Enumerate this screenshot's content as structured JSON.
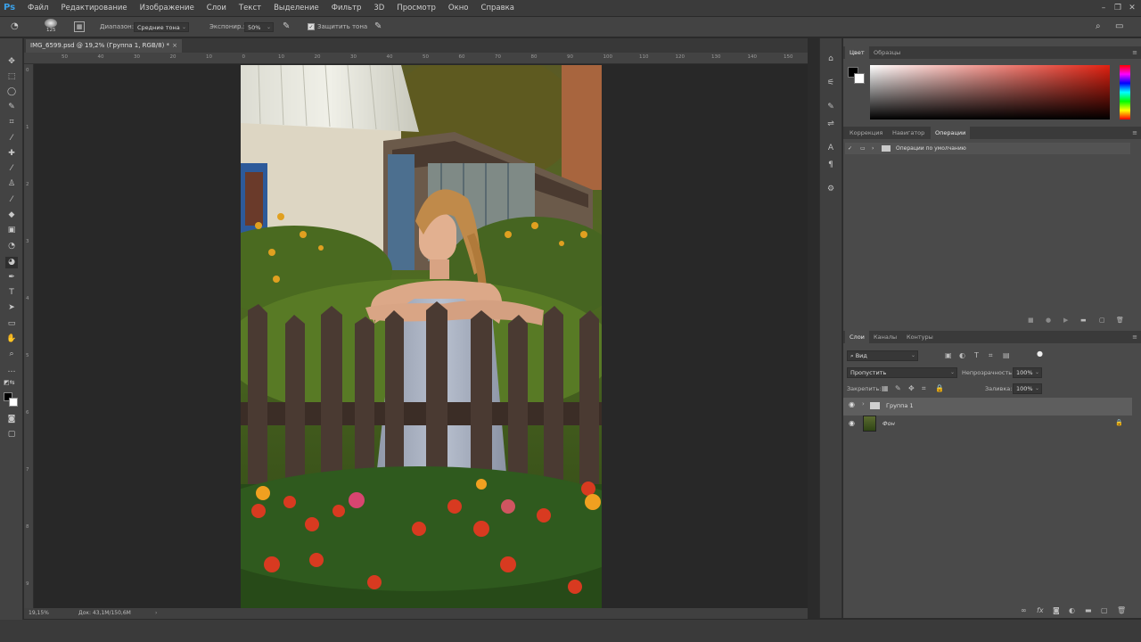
{
  "app": {
    "logo": "Ps"
  },
  "menu": [
    "Файл",
    "Редактирование",
    "Изображение",
    "Слои",
    "Текст",
    "Выделение",
    "Фильтр",
    "3D",
    "Просмотр",
    "Окно",
    "Справка"
  ],
  "options": {
    "brush_size": "125",
    "range_label": "Диапазон:",
    "range_value": "Средние тона",
    "exposure_label": "Экспонир.:",
    "exposure_value": "50%",
    "protect_tones": "Защитить тона"
  },
  "document": {
    "tab_title": "IMG_6599.psd @ 19,2% (Группа 1, RGB/8) *",
    "ruler_h": [
      "50",
      "40",
      "30",
      "20",
      "10",
      "0",
      "10",
      "20",
      "30",
      "40",
      "50",
      "60",
      "70",
      "80",
      "90",
      "100",
      "110",
      "120",
      "130",
      "140",
      "150"
    ],
    "ruler_v": [
      "0",
      "1",
      "2",
      "3",
      "4",
      "5",
      "6",
      "7",
      "8",
      "9"
    ],
    "zoom": "19,15%",
    "doc_info": "Док: 43,1M/150,6M"
  },
  "color_panel": {
    "tabs": [
      "Цвет",
      "Образцы"
    ],
    "accent": "#e02010"
  },
  "actions_panel": {
    "tabs": [
      "Коррекция",
      "Навигатор",
      "Операции"
    ],
    "items": [
      {
        "label": "Операции по умолчанию"
      }
    ]
  },
  "layers_panel": {
    "tabs": [
      "Слои",
      "Каналы",
      "Контуры"
    ],
    "filter": "Вид",
    "blend_mode": "Пропустить",
    "opacity_label": "Непрозрачность:",
    "opacity_value": "100%",
    "lock_label": "Закрепить:",
    "fill_label": "Заливка:",
    "fill_value": "100%",
    "layers": [
      {
        "name": "Группа 1",
        "type": "group",
        "selected": true
      },
      {
        "name": "Фон",
        "type": "image",
        "locked": true
      }
    ]
  }
}
